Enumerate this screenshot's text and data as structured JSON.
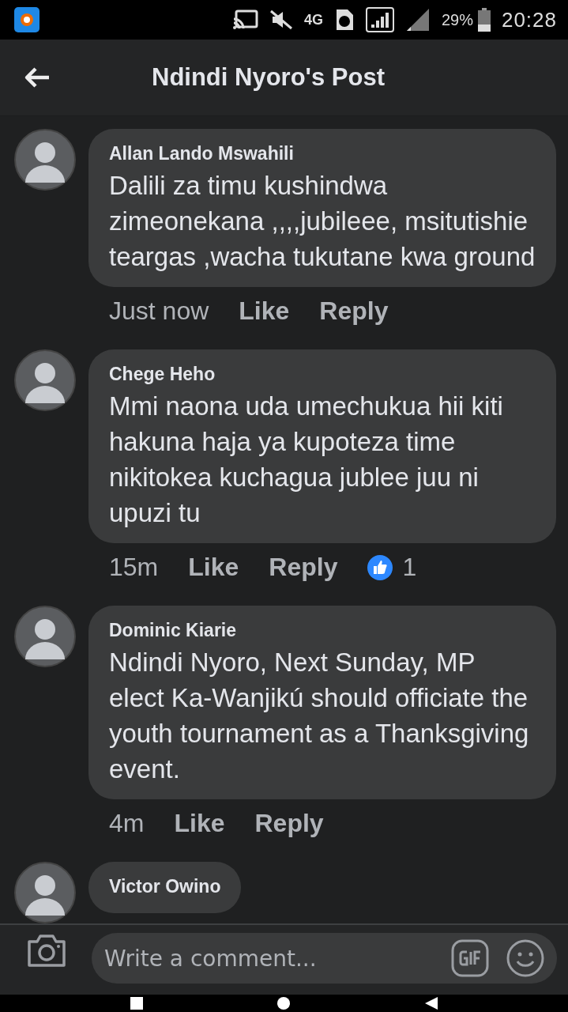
{
  "status_bar": {
    "network": "4G",
    "battery": "29%",
    "time": "20:28"
  },
  "header": {
    "title": "Ndindi Nyoro's Post"
  },
  "comments": [
    {
      "author": "Allan Lando Mswahili",
      "text": "Dalili za timu kushindwa zimeonekana ,,,,jubileee, msitutishie teargas ,wacha tukutane kwa ground",
      "time": "Just now",
      "actions": [
        "Like",
        "Reply"
      ]
    },
    {
      "author": "Chege Heho",
      "text": "Mmi naona uda umechukua hii kiti hakuna haja ya kupoteza time nikitokea kuchagua jublee juu ni upuzi tu",
      "time": "15m",
      "actions": [
        "Like",
        "Reply"
      ],
      "reactions": "1"
    },
    {
      "author": "Dominic Kiarie",
      "text": "Ndindi Nyoro, Next Sunday, MP elect Ka-Wanjikú should officiate the youth tournament as a Thanksgiving event.",
      "time": "4m",
      "actions": [
        "Like",
        "Reply"
      ]
    },
    {
      "author": "Victor Owino"
    }
  ],
  "composer": {
    "placeholder": "Write a comment..."
  }
}
